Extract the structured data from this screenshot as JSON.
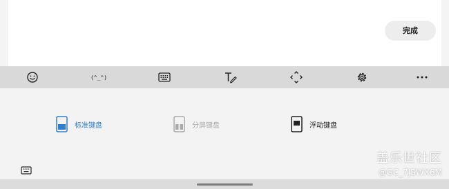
{
  "editor": {
    "done_label": "完成"
  },
  "toolbar": {
    "kaomoji_label": "(^_^)"
  },
  "keyboard_modes": [
    {
      "label": "标准键盘",
      "state": "selected",
      "color": "#2f7fd0"
    },
    {
      "label": "分屏键盘",
      "state": "disabled",
      "color": "#a9a9a9"
    },
    {
      "label": "浮动键盘",
      "state": "normal",
      "color": "#222222"
    }
  ],
  "watermark": {
    "site": "盖乐世社区",
    "user": "@GC_7JSWX6M"
  }
}
